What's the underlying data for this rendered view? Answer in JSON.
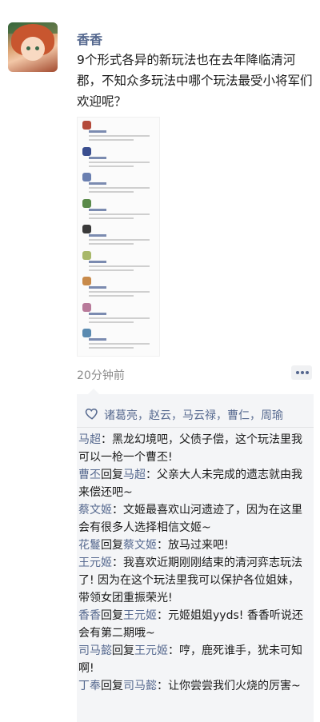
{
  "post": {
    "username": "香香",
    "text": "9个形式各异的新玩法也在去年降临清河郡，不知众多玩法中哪个玩法最受小将军们欢迎呢？",
    "time": "20分钟前"
  },
  "thumbnail": {
    "items": [
      {
        "title": "汉中争霸",
        "color": "#b44a3a"
      },
      {
        "title": "黑龙幻境",
        "color": "#3a4e8f"
      },
      {
        "title": "战功演武",
        "color": "#6a7fb0"
      },
      {
        "title": "聚魂之战",
        "color": "#5a8a4a"
      },
      {
        "title": "清河奕棋",
        "color": "#3a3a3a"
      },
      {
        "title": "时之旅影",
        "color": "#a8b86a"
      },
      {
        "title": "香雾之宴",
        "color": "#c88a4a"
      },
      {
        "title": "山河遗迹",
        "color": "#b87a9a"
      },
      {
        "title": "清河奕志",
        "color": "#5a8ab0"
      }
    ]
  },
  "interactions": {
    "likes": "诸葛亮，赵云，马云禄，曹仁，周瑜",
    "comments": [
      {
        "author": "马超",
        "reply_to": "",
        "text": "黑龙幻境吧，父债子偿，这个玩法里我可以一枪一个曹丕!"
      },
      {
        "author": "曹丕",
        "reply_to": "马超",
        "text": "父亲大人未完成的遗志就由我来偿还吧~"
      },
      {
        "author": "蔡文姬",
        "reply_to": "",
        "text": "文姬最喜欢山河遗迹了，因为在这里会有很多人选择相信文姬~"
      },
      {
        "author": "花鬘",
        "reply_to": "蔡文姬",
        "text": "放马过来吧!"
      },
      {
        "author": "王元姬",
        "reply_to": "",
        "text": "我喜欢近期刚刚结束的清河弈志玩法了! 因为在这个玩法里我可以保护各位姐妹，带领女团重振荣光!"
      },
      {
        "author": "香香",
        "reply_to": "王元姬",
        "text": "元姬姐姐yyds! 香香听说还会有第二期哦~"
      },
      {
        "author": "司马懿",
        "reply_to": "王元姬",
        "text": "哼，鹿死谁手，犹未可知啊!"
      },
      {
        "author": "丁奉",
        "reply_to": "司马懿",
        "text": "让你尝尝我们火烧的厉害~"
      }
    ],
    "reply_word": "回复",
    "sep_colon": "："
  },
  "colors": {
    "name_blue": "#56698f",
    "comment_bg": "#f4f5f7",
    "time_gray": "#8a8a8a"
  }
}
